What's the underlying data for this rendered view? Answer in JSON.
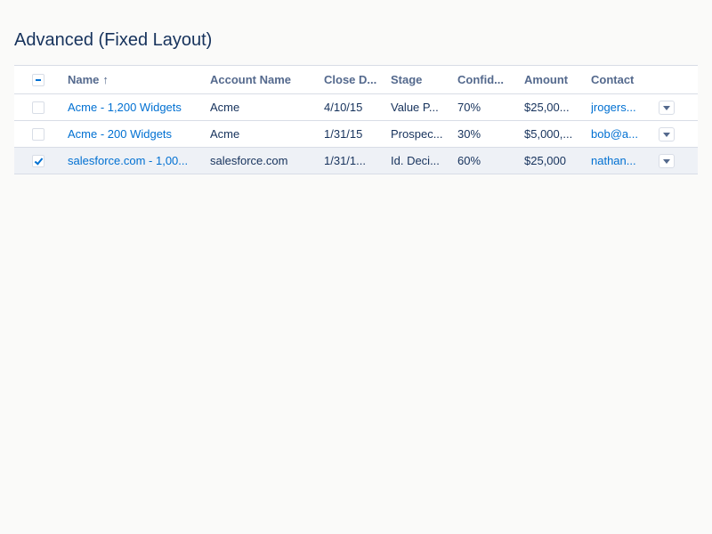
{
  "page": {
    "title": "Advanced (Fixed Layout)"
  },
  "table": {
    "header": {
      "select_all_state": "indeterminate",
      "columns": [
        {
          "key": "name",
          "label": "Name",
          "sorted": "ascending",
          "sort_icon": "↑"
        },
        {
          "key": "account",
          "label": "Account Name"
        },
        {
          "key": "close_date",
          "label": "Close D..."
        },
        {
          "key": "stage",
          "label": "Stage"
        },
        {
          "key": "confidence",
          "label": "Confid..."
        },
        {
          "key": "amount",
          "label": "Amount"
        },
        {
          "key": "contact",
          "label": "Contact"
        }
      ]
    },
    "rows": [
      {
        "checked": false,
        "name": "Acme - 1,200 Widgets",
        "account": "Acme",
        "close_date": "4/10/15",
        "stage": "Value P...",
        "confidence": "70%",
        "amount": "$25,00...",
        "contact": "jrogers..."
      },
      {
        "checked": false,
        "name": "Acme - 200 Widgets",
        "account": "Acme",
        "close_date": "1/31/15",
        "stage": "Prospec...",
        "confidence": "30%",
        "amount": "$5,000,...",
        "contact": "bob@a..."
      },
      {
        "checked": true,
        "name": "salesforce.com - 1,00...",
        "account": "salesforce.com",
        "close_date": "1/31/1...",
        "stage": "Id. Deci...",
        "confidence": "60%",
        "amount": "$25,000",
        "contact": "nathan..."
      }
    ]
  },
  "icons": {
    "sort": "arrow-up-icon",
    "row_action": "chevron-down-icon"
  },
  "colors": {
    "background": "#fafaf9",
    "text": "#16325c",
    "header_text": "#54698d",
    "link": "#0070d2",
    "border": "#d8dde6",
    "selected_row": "#eef1f6"
  }
}
